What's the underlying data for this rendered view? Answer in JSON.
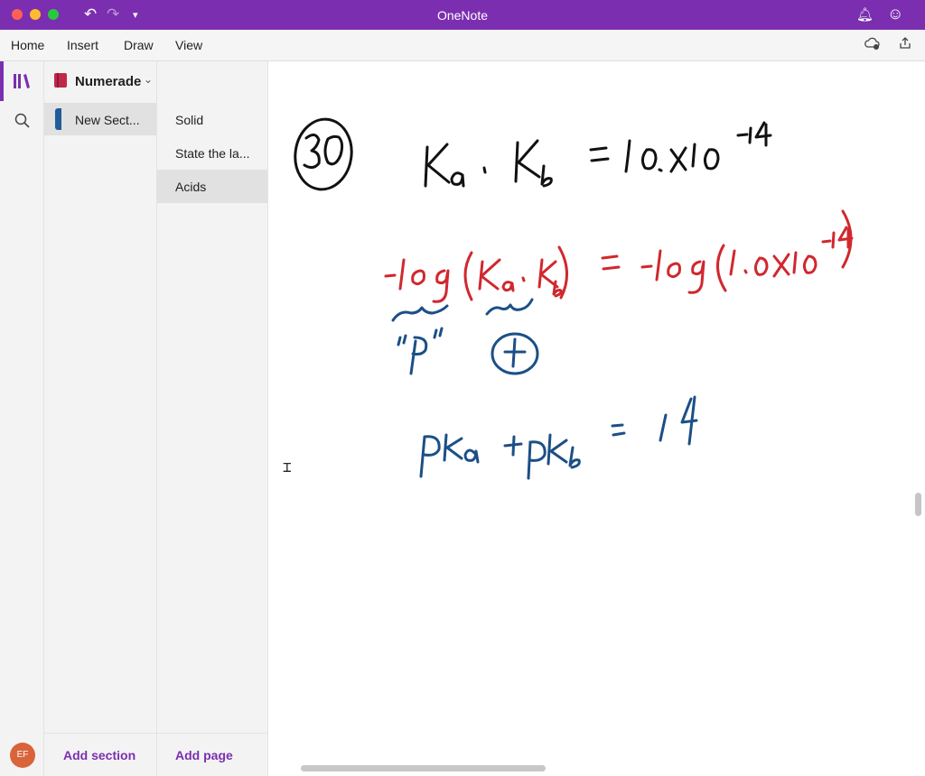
{
  "window": {
    "title": "OneNote"
  },
  "ribbon": {
    "tabs": [
      "Home",
      "Insert",
      "Draw",
      "View"
    ]
  },
  "notebook": {
    "name": "Numerade",
    "section": "New Sect..."
  },
  "pages": [
    {
      "label": "Solid",
      "selected": false
    },
    {
      "label": "State the la...",
      "selected": false
    },
    {
      "label": "Acids",
      "selected": true
    }
  ],
  "footer": {
    "add_section": "Add section",
    "add_page": "Add page",
    "avatar_initials": "EF"
  },
  "colors": {
    "accent": "#7b2fb0",
    "ink_black": "#111111",
    "ink_red": "#d0282e",
    "ink_blue": "#1c4f86"
  },
  "icons": {
    "undo": "undo-icon",
    "redo": "redo-icon",
    "notifications": "bell-icon",
    "feedback": "smiley-icon",
    "sync": "sync-cloud-icon",
    "share": "share-icon",
    "notebooks": "notebooks-icon",
    "search": "search-icon"
  }
}
